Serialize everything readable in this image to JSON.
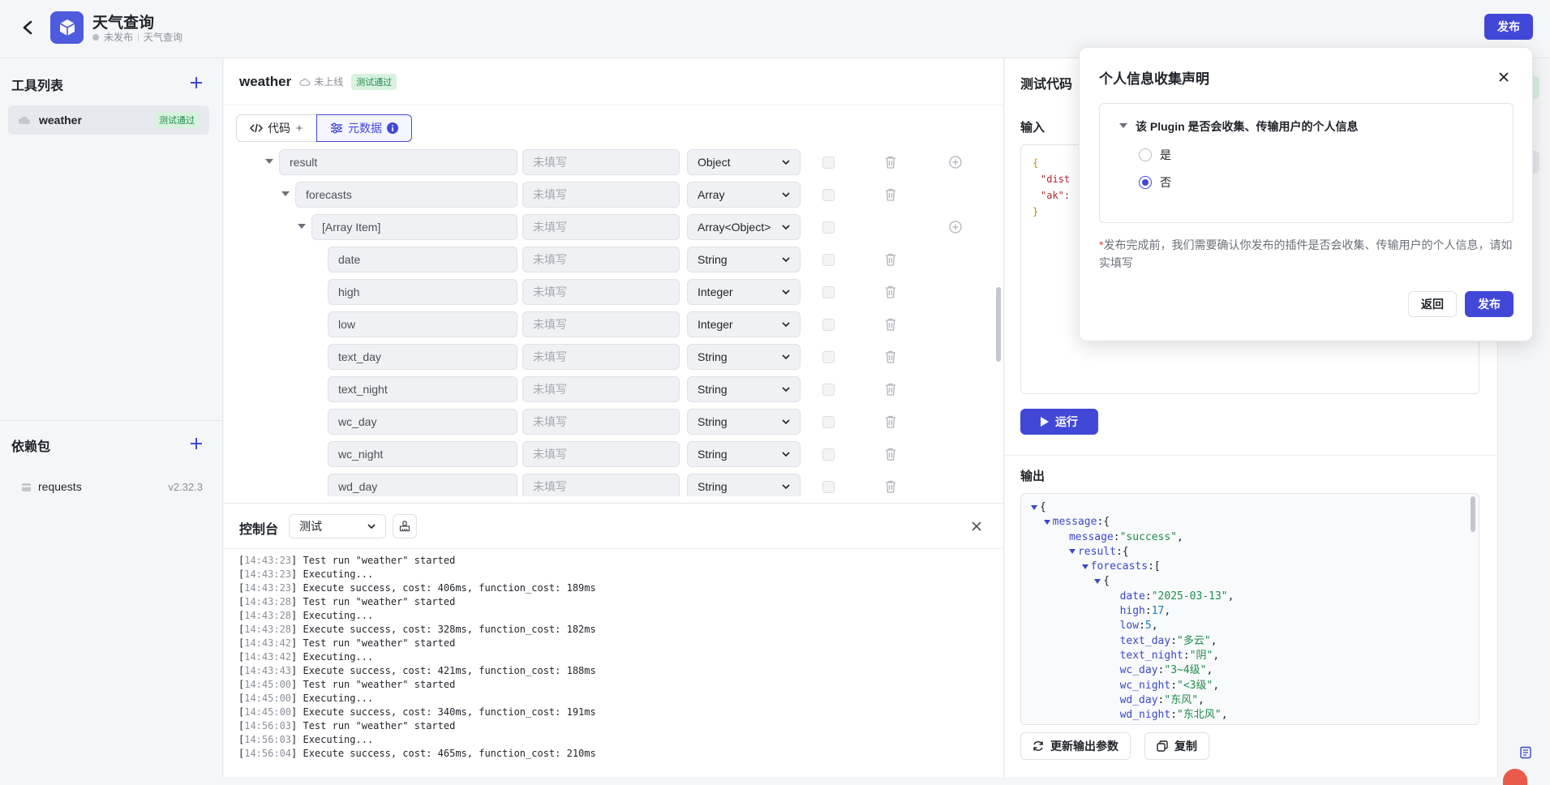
{
  "header": {
    "title": "天气查询",
    "status": "未发布",
    "subtitle": "天气查询",
    "publish_label": "发布"
  },
  "left": {
    "tools_title": "工具列表",
    "tool": {
      "name": "weather",
      "badge": "测试通过"
    },
    "deps_title": "依赖包",
    "dep": {
      "name": "requests",
      "version": "v2.32.3"
    }
  },
  "center": {
    "tool_name": "weather",
    "online_status": "未上线",
    "test_badge": "测试通过",
    "tabs": {
      "code": "代码",
      "metadata": "元数据"
    },
    "rows": [
      {
        "name": "result",
        "desc": "未填写",
        "type": "Object"
      },
      {
        "name": "forecasts",
        "desc": "未填写",
        "type": "Array"
      },
      {
        "name": "[Array Item]",
        "desc": "未填写",
        "type": "Array<Object>"
      },
      {
        "name": "date",
        "desc": "未填写",
        "type": "String"
      },
      {
        "name": "high",
        "desc": "未填写",
        "type": "Integer"
      },
      {
        "name": "low",
        "desc": "未填写",
        "type": "Integer"
      },
      {
        "name": "text_day",
        "desc": "未填写",
        "type": "String"
      },
      {
        "name": "text_night",
        "desc": "未填写",
        "type": "String"
      },
      {
        "name": "wc_day",
        "desc": "未填写",
        "type": "String"
      },
      {
        "name": "wc_night",
        "desc": "未填写",
        "type": "String"
      },
      {
        "name": "wd_day",
        "desc": "未填写",
        "type": "String"
      }
    ]
  },
  "console": {
    "title": "控制台",
    "filter": "测试",
    "logs": [
      {
        "ts": "14:43:23",
        "msg": "Test run \"weather\" started"
      },
      {
        "ts": "14:43:23",
        "msg": "Executing..."
      },
      {
        "ts": "14:43:23",
        "msg": "Execute success, cost: 406ms, function_cost: 189ms"
      },
      {
        "ts": "14:43:28",
        "msg": "Test run \"weather\" started"
      },
      {
        "ts": "14:43:28",
        "msg": "Executing..."
      },
      {
        "ts": "14:43:28",
        "msg": "Execute success, cost: 328ms, function_cost: 182ms"
      },
      {
        "ts": "14:43:42",
        "msg": "Test run \"weather\" started"
      },
      {
        "ts": "14:43:42",
        "msg": "Executing..."
      },
      {
        "ts": "14:43:43",
        "msg": "Execute success, cost: 421ms, function_cost: 188ms"
      },
      {
        "ts": "14:45:00",
        "msg": "Test run \"weather\" started"
      },
      {
        "ts": "14:45:00",
        "msg": "Executing..."
      },
      {
        "ts": "14:45:00",
        "msg": "Execute success, cost: 340ms, function_cost: 191ms"
      },
      {
        "ts": "14:56:03",
        "msg": "Test run \"weather\" started"
      },
      {
        "ts": "14:56:03",
        "msg": "Executing..."
      },
      {
        "ts": "14:56:04",
        "msg": "Execute success, cost: 465ms, function_cost: 210ms"
      }
    ]
  },
  "test": {
    "title": "测试代码",
    "input_label": "输入",
    "input_lines": [
      "{",
      "\"dist",
      "\"ak\":",
      "}"
    ],
    "run_label": "运行",
    "output_label": "输出",
    "update_label": "更新输出参数",
    "copy_label": "复制"
  },
  "modal": {
    "title": "个人信息收集声明",
    "question": "该 Plugin 是否会收集、传输用户的个人信息",
    "option_yes": "是",
    "option_no": "否",
    "selected": "否",
    "required_mark": "*",
    "note": "发布完成前，我们需要确认你发布的插件是否会收集、传输用户的个人信息，请如实填写",
    "back_label": "返回",
    "publish_label": "发布"
  },
  "colors": {
    "accent": "#4148d8",
    "success_bg": "#d8f2df",
    "success_text": "#1f8b4c"
  }
}
